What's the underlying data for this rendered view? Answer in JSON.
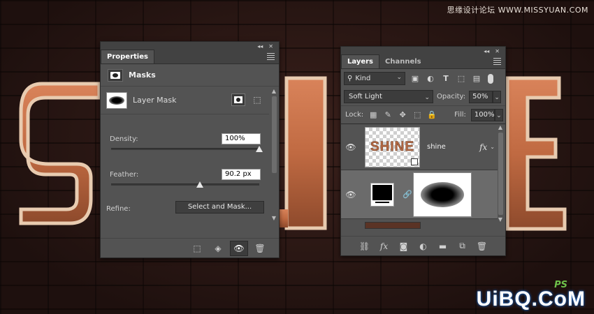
{
  "watermarks": {
    "top": "思缘设计论坛 WWW.MISSYUAN.COM",
    "bottom": "UiBQ.CoM",
    "ps": "PS"
  },
  "properties_panel": {
    "tab": "Properties",
    "header_title": "Masks",
    "layer_mask_label": "Layer Mask",
    "density_label": "Density:",
    "density_value": "100%",
    "density_level": 1.0,
    "feather_label": "Feather:",
    "feather_value": "90.2 px",
    "feather_level": 0.6,
    "refine_label": "Refine:",
    "select_and_mask": "Select and Mask...",
    "collapse_glyph": "◂◂",
    "close_glyph": "✕"
  },
  "layers_panel": {
    "tabs": [
      "Layers",
      "Channels"
    ],
    "active_tab": "Layers",
    "filter_kind": "Kind",
    "blend_mode": "Soft Light",
    "opacity_label": "Opacity:",
    "opacity_value": "50%",
    "lock_label": "Lock:",
    "fill_label": "Fill:",
    "fill_value": "100%",
    "layers": [
      {
        "name": "shine",
        "thumb_text": "SHINE",
        "fx": "fx",
        "selected": false
      },
      {
        "name": "",
        "selected": true
      }
    ],
    "collapse_glyph": "◂◂",
    "close_glyph": "✕"
  },
  "colors": {
    "panel_bg": "#535353",
    "panel_tab_bar": "#424242",
    "selected_row": "#6b6b6b",
    "copper": "#b56a44"
  }
}
